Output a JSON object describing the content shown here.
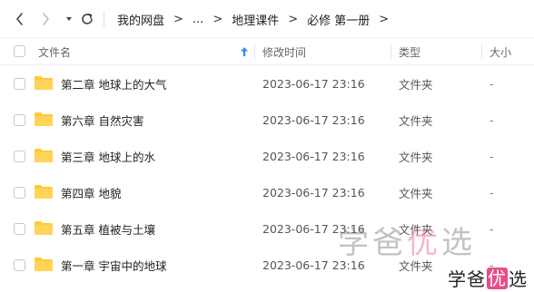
{
  "breadcrumb": {
    "items": [
      "我的网盘",
      "...",
      "地理课件",
      "必修 第一册"
    ],
    "separator": ">"
  },
  "columns": {
    "name": "文件名",
    "modified": "修改时间",
    "type": "类型",
    "size": "大小"
  },
  "files": [
    {
      "name": "第二章 地球上的大气",
      "modified": "2023-06-17 23:16",
      "type": "文件夹",
      "size": "-"
    },
    {
      "name": "第六章 自然灾害",
      "modified": "2023-06-17 23:16",
      "type": "文件夹",
      "size": "-"
    },
    {
      "name": "第三章 地球上的水",
      "modified": "2023-06-17 23:16",
      "type": "文件夹",
      "size": "-"
    },
    {
      "name": "第四章 地貌",
      "modified": "2023-06-17 23:16",
      "type": "文件夹",
      "size": "-"
    },
    {
      "name": "第五章 植被与土壤",
      "modified": "2023-06-17 23:16",
      "type": "文件夹",
      "size": "-"
    },
    {
      "name": "第一章 宇宙中的地球",
      "modified": "2023-06-17 23:16",
      "type": "文件夹",
      "size": "-"
    }
  ],
  "watermark": {
    "big_a": "学爸",
    "big_b": "优",
    "big_c": "选",
    "small_a": "学爸",
    "small_b": "优",
    "small_c": "选"
  },
  "icons": {
    "back": "chevron-left-icon",
    "forward": "chevron-right-icon",
    "history": "dropdown-triangle-icon",
    "refresh": "refresh-icon",
    "sort": "sort-up-arrow-icon",
    "folder": "folder-icon"
  },
  "colors": {
    "folder": "#ffc93c",
    "sort_arrow": "#3a8ee6",
    "watermark_accent": "#e84c8a"
  }
}
